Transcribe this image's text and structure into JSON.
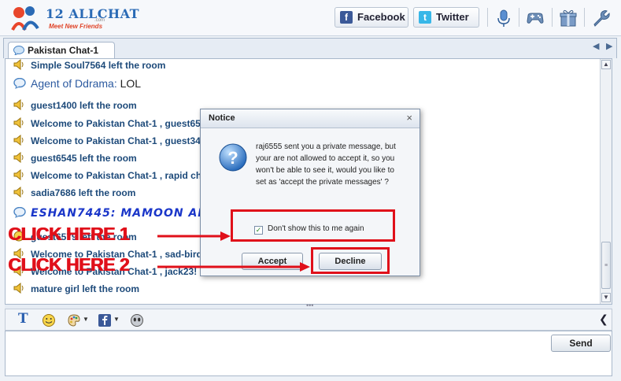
{
  "header": {
    "logo_title": "12 ALLCHAT",
    "logo_com": ".com",
    "logo_subtitle": "Meet New Friends",
    "facebook_label": "Facebook",
    "twitter_label": "Twitter",
    "icons": [
      "microphone-icon",
      "gamepad-icon",
      "gift-icon",
      "wrench-icon"
    ]
  },
  "tab": {
    "label": "Pakistan Chat-1"
  },
  "messages": [
    {
      "kind": "system",
      "text": "Simple Soul7564 left the room"
    },
    {
      "kind": "user",
      "user": "Agent of Ddrama:",
      "text": " LOL"
    },
    {
      "kind": "system",
      "text": "guest1400 left the room"
    },
    {
      "kind": "system",
      "text": "Welcome to Pakistan Chat-1 , guest65"
    },
    {
      "kind": "system",
      "text": "Welcome to Pakistan Chat-1 , guest34"
    },
    {
      "kind": "system",
      "text": "guest6545 left the room"
    },
    {
      "kind": "system",
      "text": "Welcome to Pakistan Chat-1 , rapid cha"
    },
    {
      "kind": "system",
      "text": "sadia7686 left the room"
    },
    {
      "kind": "big",
      "text": "ESHAN7445: MAMOON AI"
    },
    {
      "kind": "system",
      "text": "guest6579 left the room"
    },
    {
      "kind": "system",
      "text": "Welcome to Pakistan Chat-1 , sad-bird"
    },
    {
      "kind": "system",
      "text": "Welcome to Pakistan Chat-1 , jack23!"
    },
    {
      "kind": "system",
      "text": "mature girl left the room"
    }
  ],
  "toolbar": {
    "text_icon": "T",
    "icons": [
      "text-format-icon",
      "emoticon-icon",
      "palette-icon",
      "facebook-share-icon",
      "avatar-icon"
    ]
  },
  "send_label": "Send",
  "dialog": {
    "title": "Notice",
    "close": "×",
    "message": "raj6555 sent you a private message, but your are not allowed to accept it, so you won't be able to see it, would you like to set as 'accept the private messages' ?",
    "checkbox_label": "Don't show this to me again",
    "checkbox_checked": true,
    "accept_label": "Accept",
    "decline_label": "Decline"
  },
  "annotations": {
    "label_1": "CLICK HERE 1",
    "label_2": "CLICK HERE 2",
    "color": "#e0101a"
  }
}
